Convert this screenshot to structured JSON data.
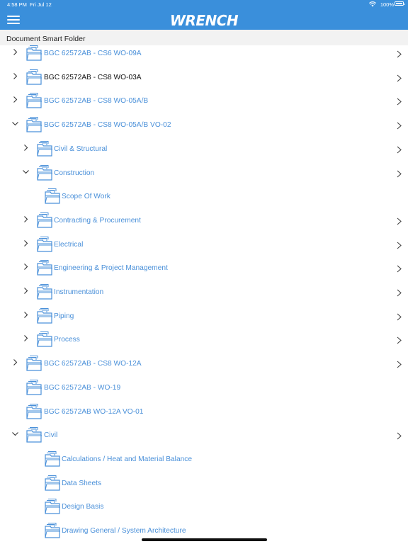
{
  "status_bar": {
    "time": "4:58 PM",
    "date": "Fri Jul 12",
    "battery": "100%"
  },
  "header": {
    "logo": "WRENCH",
    "menu_icon": "hamburger-icon"
  },
  "section_title": "Document Smart Folder",
  "colors": {
    "header_bg": "#3a8fdb",
    "link": "#4a90d9",
    "icon": "#4a90d9"
  },
  "tree": [
    {
      "label": "BGC 62572AB - CS6 WO-09A",
      "level": 0,
      "expander": "collapsed",
      "arrow": true,
      "dark": false
    },
    {
      "label": "BGC 62572AB - CS8 WO-03A",
      "level": 0,
      "expander": "collapsed",
      "arrow": true,
      "dark": true
    },
    {
      "label": "BGC 62572AB - CS8 WO-05A/B",
      "level": 0,
      "expander": "collapsed",
      "arrow": true,
      "dark": false
    },
    {
      "label": "BGC 62572AB - CS8 WO-05A/B VO-02",
      "level": 0,
      "expander": "expanded",
      "arrow": true,
      "dark": false
    },
    {
      "label": "Civil & Structural",
      "level": 1,
      "expander": "collapsed",
      "arrow": true,
      "dark": false
    },
    {
      "label": "Construction",
      "level": 1,
      "expander": "expanded",
      "arrow": true,
      "dark": false
    },
    {
      "label": "Scope Of Work",
      "level": 2,
      "expander": "none",
      "arrow": false,
      "dark": false
    },
    {
      "label": "Contracting & Procurement",
      "level": 1,
      "expander": "collapsed",
      "arrow": true,
      "dark": false
    },
    {
      "label": "Electrical",
      "level": 1,
      "expander": "collapsed",
      "arrow": true,
      "dark": false
    },
    {
      "label": "Engineering & Project Management",
      "level": 1,
      "expander": "collapsed",
      "arrow": true,
      "dark": false
    },
    {
      "label": "Instrumentation",
      "level": 1,
      "expander": "collapsed",
      "arrow": true,
      "dark": false
    },
    {
      "label": "Piping",
      "level": 1,
      "expander": "collapsed",
      "arrow": true,
      "dark": false
    },
    {
      "label": "Process",
      "level": 1,
      "expander": "collapsed",
      "arrow": true,
      "dark": false
    },
    {
      "label": "BGC 62572AB - CS8 WO-12A",
      "level": 0,
      "expander": "collapsed",
      "arrow": true,
      "dark": false
    },
    {
      "label": "BGC 62572AB - WO-19",
      "level": 0,
      "expander": "none",
      "arrow": false,
      "dark": false
    },
    {
      "label": "BGC 62572AB WO-12A VO-01",
      "level": 0,
      "expander": "none",
      "arrow": false,
      "dark": false
    },
    {
      "label": "Civil",
      "level": 0,
      "expander": "expanded",
      "arrow": true,
      "dark": false
    },
    {
      "label": "Calculations / Heat and Material Balance",
      "level": 2,
      "expander": "none",
      "arrow": false,
      "dark": false
    },
    {
      "label": "Data Sheets",
      "level": 2,
      "expander": "none",
      "arrow": false,
      "dark": false
    },
    {
      "label": "Design Basis",
      "level": 2,
      "expander": "none",
      "arrow": false,
      "dark": false
    },
    {
      "label": "Drawing General / System Architecture",
      "level": 2,
      "expander": "none",
      "arrow": false,
      "dark": false
    }
  ]
}
